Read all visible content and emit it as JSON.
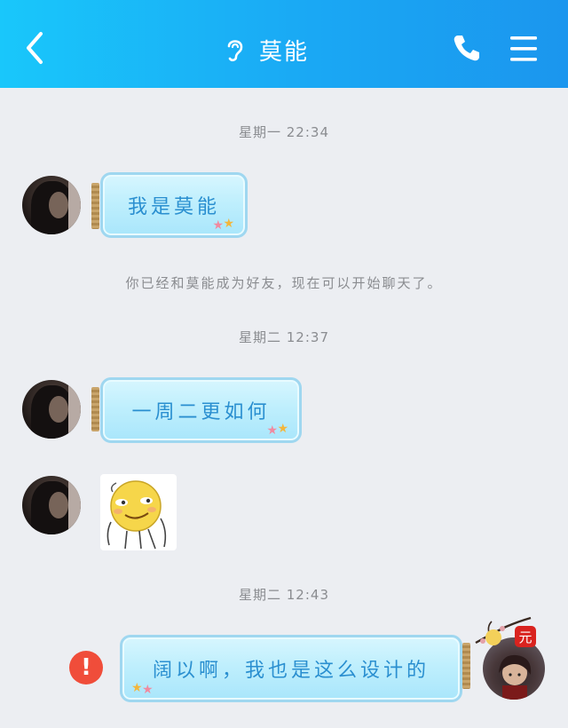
{
  "header": {
    "title": "莫能",
    "back_icon": "chevron-left-icon",
    "ear_icon": "ear-icon",
    "call_icon": "phone-icon",
    "menu_icon": "menu-icon",
    "background": "#1aa8f4"
  },
  "messages": {
    "timestamp_1": "星期一 22:34",
    "msg_1": "我是莫能",
    "system_notice": "你已经和莫能成为好友，现在可以开始聊天了。",
    "timestamp_2": "星期二 12:37",
    "msg_2": "一周二更如何",
    "msg_3_sticker": "laughing-face-sticker",
    "timestamp_3": "星期二 12:43",
    "msg_4": "阔以啊，我也是这么设计的",
    "msg_4_status": "error-icon"
  },
  "self_avatar": {
    "badge_text": "元"
  }
}
